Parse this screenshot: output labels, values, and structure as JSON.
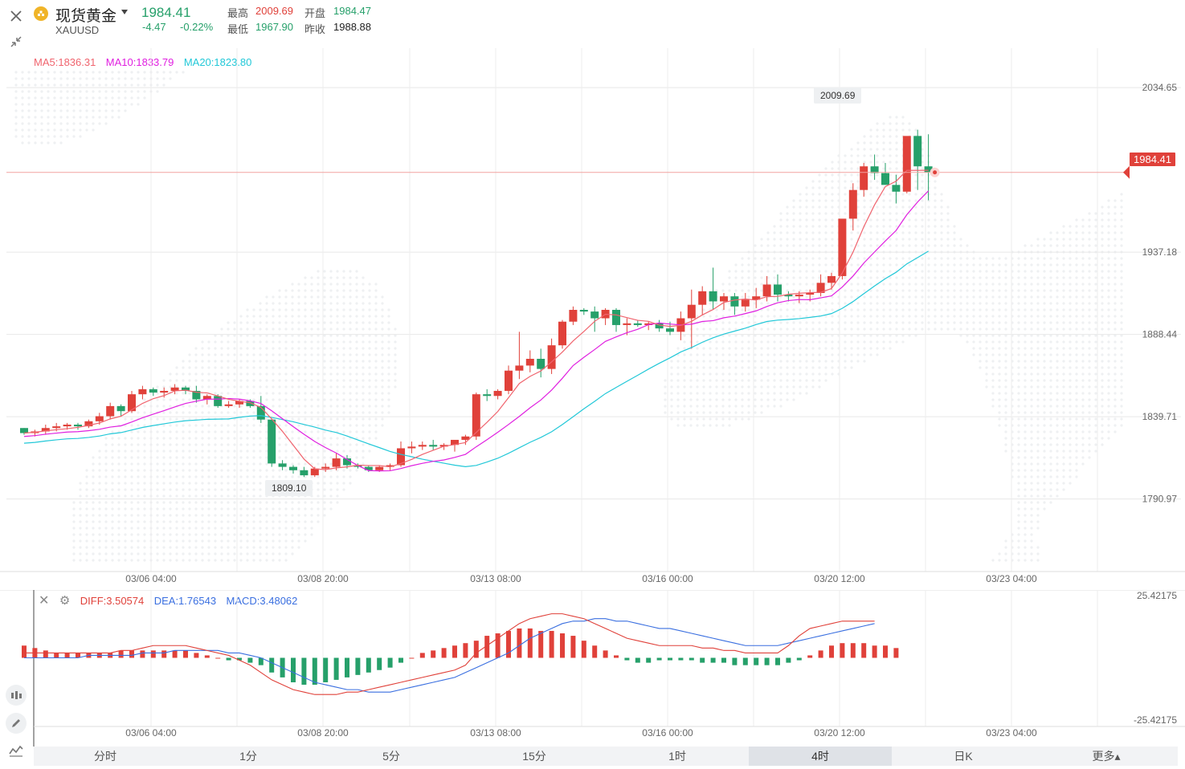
{
  "header": {
    "name": "现货黄金",
    "symbol": "XAUUSD",
    "price": "1984.41",
    "change": "-4.47",
    "change_pct": "-0.22%",
    "high_label": "最高",
    "high": "2009.69",
    "low_label": "最低",
    "low": "1967.90",
    "open_label": "开盘",
    "open": "1984.47",
    "prev_close_label": "昨收",
    "prev_close": "1988.88"
  },
  "ma_legend": {
    "ma5": "MA5:1836.31",
    "ma10": "MA10:1833.79",
    "ma20": "MA20:1823.80",
    "colors": {
      "ma5": "#f0646e",
      "ma10": "#e020e0",
      "ma20": "#22c8d8"
    }
  },
  "macd_legend": {
    "diff": "DIFF:3.50574",
    "dea": "DEA:1.76543",
    "macd": "MACD:3.48062",
    "colors": {
      "diff": "#e0413a",
      "dea": "#3a6fe0"
    }
  },
  "markers": {
    "high": "2009.69",
    "low": "1809.10",
    "current": "1984.41"
  },
  "tabs": [
    {
      "label": "分时",
      "active": false
    },
    {
      "label": "1分",
      "active": false
    },
    {
      "label": "5分",
      "active": false
    },
    {
      "label": "15分",
      "active": false
    },
    {
      "label": "1时",
      "active": false
    },
    {
      "label": "4时",
      "active": true
    },
    {
      "label": "日K",
      "active": false
    },
    {
      "label": "更多▴",
      "active": false
    }
  ],
  "icons": [
    "close-icon",
    "collapse-icon",
    "gold-coin-icon",
    "dropdown-caret-icon",
    "settings-icon",
    "candle-icon",
    "pencil-icon",
    "indicator-icon"
  ],
  "chart_data": [
    {
      "type": "candlestick",
      "title": "现货黄金 XAUUSD",
      "y_ticks": [
        "2034.65",
        "1937.18",
        "1888.44",
        "1839.71",
        "1790.97"
      ],
      "x_ticks": [
        "03/06 04:00",
        "03/08 20:00",
        "03/13 08:00",
        "03/16 00:00",
        "03/20 12:00",
        "03/23 04:00"
      ],
      "ylim": [
        1748,
        2058
      ],
      "grid": true,
      "colors": {
        "up": "#e0413a",
        "down": "#26a06a"
      },
      "candles": [
        [
          1833,
          1833,
          1829,
          1830
        ],
        [
          1830,
          1832,
          1828,
          1831
        ],
        [
          1831,
          1835,
          1829,
          1833
        ],
        [
          1833,
          1836,
          1831,
          1834
        ],
        [
          1834,
          1836,
          1832,
          1835
        ],
        [
          1835,
          1836,
          1832,
          1834
        ],
        [
          1834,
          1838,
          1833,
          1837
        ],
        [
          1837,
          1842,
          1835,
          1840
        ],
        [
          1840,
          1848,
          1838,
          1846
        ],
        [
          1846,
          1847,
          1840,
          1843
        ],
        [
          1843,
          1855,
          1842,
          1853
        ],
        [
          1853,
          1858,
          1850,
          1856
        ],
        [
          1856,
          1857,
          1852,
          1854
        ],
        [
          1854,
          1857,
          1851,
          1855
        ],
        [
          1855,
          1859,
          1853,
          1857
        ],
        [
          1857,
          1858,
          1853,
          1855
        ],
        [
          1855,
          1858,
          1848,
          1850
        ],
        [
          1850,
          1853,
          1847,
          1852
        ],
        [
          1852,
          1853,
          1845,
          1846
        ],
        [
          1846,
          1849,
          1845,
          1847
        ],
        [
          1847,
          1850,
          1845,
          1849
        ],
        [
          1849,
          1850,
          1845,
          1846
        ],
        [
          1846,
          1852,
          1836,
          1838
        ],
        [
          1838,
          1838,
          1810,
          1812
        ],
        [
          1812,
          1814,
          1808,
          1810
        ],
        [
          1810,
          1811,
          1806,
          1808
        ],
        [
          1808,
          1810,
          1804,
          1805
        ],
        [
          1805,
          1810,
          1804,
          1809
        ],
        [
          1809,
          1812,
          1807,
          1810
        ],
        [
          1810,
          1818,
          1808,
          1815
        ],
        [
          1815,
          1817,
          1809,
          1811
        ],
        [
          1811,
          1812,
          1809,
          1810
        ],
        [
          1810,
          1811,
          1807,
          1808
        ],
        [
          1808,
          1811,
          1807,
          1810
        ],
        [
          1810,
          1812,
          1808,
          1811
        ],
        [
          1811,
          1825,
          1810,
          1821
        ],
        [
          1821,
          1825,
          1818,
          1822
        ],
        [
          1822,
          1825,
          1820,
          1823
        ],
        [
          1823,
          1826,
          1820,
          1822
        ],
        [
          1822,
          1824,
          1820,
          1823
        ],
        [
          1823,
          1825,
          1819,
          1826
        ],
        [
          1826,
          1829,
          1823,
          1828
        ],
        [
          1828,
          1854,
          1826,
          1853
        ],
        [
          1853,
          1856,
          1849,
          1852
        ],
        [
          1852,
          1856,
          1850,
          1855
        ],
        [
          1855,
          1870,
          1853,
          1867
        ],
        [
          1867,
          1890,
          1862,
          1870
        ],
        [
          1870,
          1879,
          1866,
          1874
        ],
        [
          1874,
          1880,
          1863,
          1868
        ],
        [
          1868,
          1886,
          1865,
          1882
        ],
        [
          1882,
          1897,
          1880,
          1896
        ],
        [
          1896,
          1905,
          1894,
          1903
        ],
        [
          1903,
          1904,
          1900,
          1902
        ],
        [
          1902,
          1905,
          1890,
          1898
        ],
        [
          1898,
          1904,
          1894,
          1903
        ],
        [
          1903,
          1904,
          1890,
          1894
        ],
        [
          1894,
          1898,
          1888,
          1895
        ],
        [
          1895,
          1897,
          1893,
          1894
        ],
        [
          1894,
          1896,
          1891,
          1895
        ],
        [
          1895,
          1897,
          1890,
          1892
        ],
        [
          1892,
          1896,
          1888,
          1890
        ],
        [
          1890,
          1902,
          1885,
          1898
        ],
        [
          1898,
          1915,
          1880,
          1906
        ],
        [
          1906,
          1917,
          1900,
          1914
        ],
        [
          1914,
          1928,
          1903,
          1908
        ],
        [
          1908,
          1913,
          1903,
          1911
        ],
        [
          1911,
          1913,
          1900,
          1905
        ],
        [
          1905,
          1913,
          1902,
          1909
        ],
        [
          1909,
          1916,
          1904,
          1911
        ],
        [
          1911,
          1923,
          1908,
          1918
        ],
        [
          1918,
          1924,
          1908,
          1912
        ],
        [
          1912,
          1914,
          1908,
          1911
        ],
        [
          1911,
          1914,
          1907,
          1912
        ],
        [
          1912,
          1915,
          1908,
          1913
        ],
        [
          1913,
          1924,
          1911,
          1919
        ],
        [
          1919,
          1925,
          1915,
          1923
        ],
        [
          1923,
          1945,
          1921,
          1957
        ],
        [
          1957,
          1978,
          1950,
          1974
        ],
        [
          1974,
          1990,
          1970,
          1988
        ],
        [
          1988,
          1995,
          1980,
          1984
        ],
        [
          1984,
          1990,
          1979,
          1977
        ],
        [
          1977,
          1983,
          1966,
          1973
        ],
        [
          1973,
          1995,
          1972,
          2006
        ],
        [
          2006,
          2009.69,
          1974,
          1988
        ],
        [
          1988,
          2007,
          1967.9,
          1984.41
        ]
      ],
      "ma5_last": "1836.31",
      "ma10_last": "1833.79",
      "ma20_last": "1823.80"
    },
    {
      "type": "bar",
      "title": "MACD",
      "y_ticks": [
        "25.42175",
        "-25.42175"
      ],
      "x_ticks": [
        "03/06 04:00",
        "03/08 20:00",
        "03/13 08:00",
        "03/16 00:00",
        "03/20 12:00",
        "03/23 04:00"
      ],
      "ylim": [
        -25.42175,
        25.42175
      ],
      "histogram": [
        5,
        4,
        3,
        2,
        2,
        2,
        2,
        2,
        2,
        3,
        3,
        3,
        3,
        3,
        3,
        3,
        2,
        1,
        0,
        -1,
        -1,
        -2,
        -3,
        -6,
        -8,
        -10,
        -11,
        -11,
        -10,
        -9,
        -8,
        -7,
        -6,
        -5,
        -4,
        -2,
        0,
        2,
        3,
        4,
        5,
        6,
        7,
        9,
        10,
        11,
        12,
        12,
        11,
        11,
        10,
        9,
        7,
        5,
        3,
        1,
        -1,
        -2,
        -2,
        -1,
        -1,
        -1,
        -1,
        -2,
        -2,
        -2,
        -3,
        -3,
        -3,
        -3,
        -3,
        -2,
        -1,
        1,
        3,
        5,
        6,
        6,
        6,
        5,
        5,
        4
      ],
      "diff": [
        2,
        2,
        2,
        2,
        2,
        2,
        2,
        2,
        2,
        3,
        3,
        4,
        5,
        5,
        5,
        5,
        4,
        3,
        2,
        1,
        -1,
        -3,
        -6,
        -9,
        -11,
        -13,
        -14,
        -15,
        -15,
        -15,
        -14,
        -14,
        -13,
        -12,
        -11,
        -10,
        -9,
        -8,
        -7,
        -6,
        -5,
        -3,
        2,
        5,
        8,
        11,
        14,
        16,
        17,
        18,
        18,
        17,
        16,
        14,
        12,
        10,
        8,
        7,
        6,
        5,
        5,
        5,
        5,
        4,
        4,
        3,
        3,
        2,
        2,
        2,
        2,
        5,
        9,
        12,
        13,
        14,
        15,
        15,
        15,
        15
      ],
      "dea": [
        0,
        0,
        0,
        0,
        0,
        0,
        1,
        1,
        1,
        1,
        1,
        2,
        2,
        2,
        3,
        3,
        3,
        3,
        3,
        2,
        2,
        1,
        0,
        -2,
        -4,
        -6,
        -8,
        -10,
        -11,
        -12,
        -13,
        -13,
        -14,
        -14,
        -14,
        -13,
        -12,
        -11,
        -10,
        -9,
        -8,
        -6,
        -4,
        -2,
        0,
        2,
        5,
        8,
        10,
        12,
        14,
        15,
        15,
        16,
        16,
        15,
        15,
        14,
        13,
        12,
        12,
        11,
        10,
        9,
        8,
        7,
        6,
        5,
        5,
        5,
        5,
        6,
        7,
        8,
        9,
        10,
        11,
        12,
        13,
        14
      ]
    }
  ]
}
